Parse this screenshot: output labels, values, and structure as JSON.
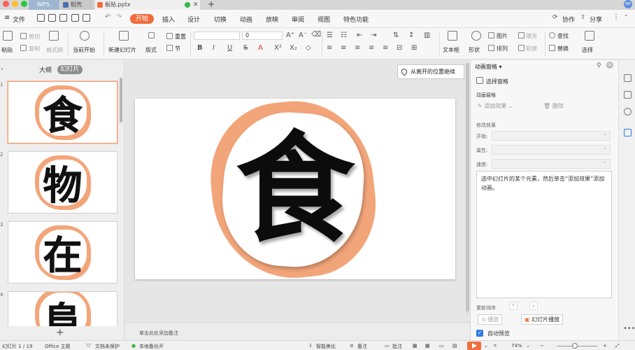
{
  "titlebar": {
    "tabs": [
      {
        "label": "WPS"
      },
      {
        "label": "稻壳"
      },
      {
        "label": "板贴.pptx"
      }
    ],
    "user_initials": "WP"
  },
  "menubar": {
    "file_label": "文件",
    "items": [
      "开始",
      "插入",
      "设计",
      "切换",
      "动画",
      "放映",
      "审阅",
      "视图",
      "特色功能"
    ],
    "active": "开始",
    "collab_label": "协作",
    "share_label": "分享"
  },
  "ribbon": {
    "paste": "粘贴",
    "cut": "剪切",
    "copy": "复制",
    "format_painter": "格式刷",
    "start_from_current": "当前开始",
    "new_slide": "新建幻灯片",
    "layout": "版式",
    "section": "节",
    "reset": "重置",
    "font_size": "0",
    "textbox": "文本框",
    "shape": "形状",
    "picture": "图片",
    "arrange": "排列",
    "fill": "填充",
    "outline": "轮廓",
    "find": "查找",
    "replace": "替换",
    "select": "选择"
  },
  "left_panel": {
    "tab_outline": "大纲",
    "tab_slides": "幻灯片",
    "slides": [
      {
        "num": "1",
        "glyph": "食"
      },
      {
        "num": "2",
        "glyph": "物"
      },
      {
        "num": "3",
        "glyph": "在"
      },
      {
        "num": "4",
        "glyph": "阜"
      }
    ]
  },
  "canvas": {
    "glyph": "食",
    "resume_label": "从离开的位置继续",
    "notes_placeholder": "单击此处添加备注"
  },
  "right_panel": {
    "title": "动画窗格",
    "selection_pane": "选择窗格",
    "section_animation": "动画窗格",
    "add_effect": "添加效果",
    "delete": "删除",
    "modify_effect": "修改效果",
    "start_label": "开始:",
    "property_label": "属性:",
    "speed_label": "速度:",
    "hint": "选中幻灯片的某个元素，然后单击“添加效果”添加动画。",
    "reorder": "重新排序",
    "play": "播放",
    "slideshow": "幻灯片播放",
    "autopreview": "自动预览"
  },
  "statusbar": {
    "slide_counter": "幻灯片 1 / 19",
    "theme": "Office 主题",
    "doc_protect": "文档未保护",
    "backup": "本地备份开",
    "beautify": "智能美化",
    "notes": "备注",
    "comments": "批注",
    "zoom": "74%"
  },
  "colors": {
    "accent": "#f06d3c",
    "sticker_orange": "#f3a57a",
    "check_blue": "#2f7be5"
  }
}
